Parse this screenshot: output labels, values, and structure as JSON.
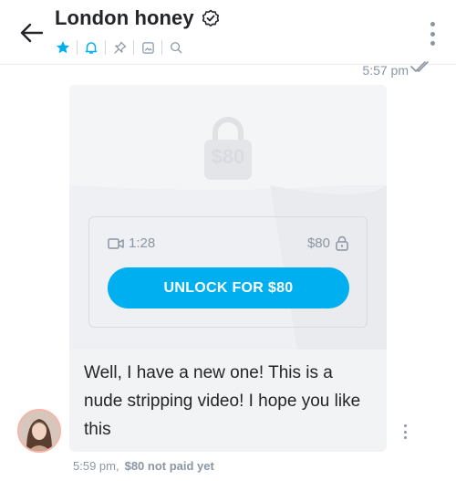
{
  "header": {
    "title": "London honey",
    "back_icon": "arrow-left-icon",
    "verified_icon": "verified-badge-icon",
    "actions": [
      "star-icon",
      "bell-icon",
      "pin-icon",
      "media-icon",
      "search-icon"
    ],
    "menu_icon": "more-vertical-icon",
    "accent": "#00aff0"
  },
  "message": {
    "sent_time": "5:57 pm",
    "locked_price_badge": "$80",
    "video_duration": "1:28",
    "price": "$80",
    "unlock_label": "UNLOCK FOR $80",
    "text": "Well, I have a new one! This is a nude stripping video! I hope you like this",
    "footer_time": "5:59 pm,",
    "footer_status": "$80 not paid yet"
  }
}
